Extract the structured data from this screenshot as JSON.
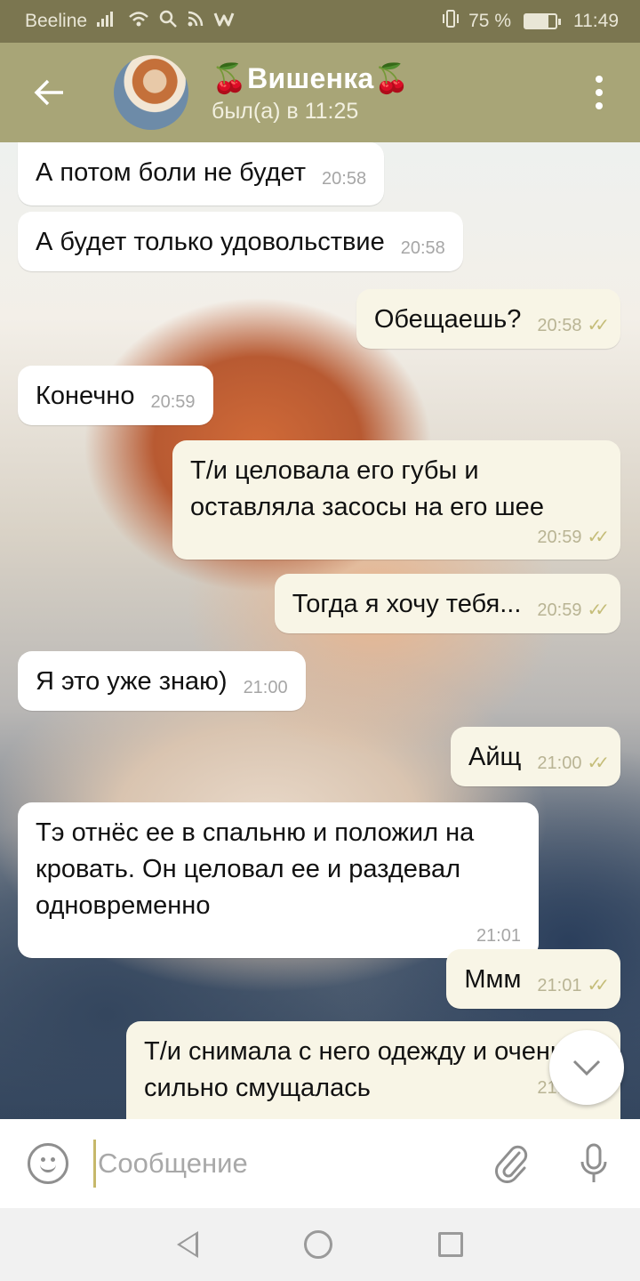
{
  "status_bar": {
    "carrier": "Beeline",
    "battery_text": "75 %",
    "battery_level": 0.75,
    "time": "11:49"
  },
  "header": {
    "title": "🍒Вишенка🍒",
    "status": "был(а) в 11:25"
  },
  "messages": [
    {
      "dir": "in",
      "text": "А потом боли не будет",
      "time": "20:58"
    },
    {
      "dir": "in",
      "text": "А будет только удовольствие",
      "time": "20:58"
    },
    {
      "dir": "out",
      "text": "Обещаешь?",
      "time": "20:58"
    },
    {
      "dir": "in",
      "text": "Конечно",
      "time": "20:59"
    },
    {
      "dir": "out",
      "text": "Т/и целовала его губы и оставляла засосы на его шее",
      "time": "20:59"
    },
    {
      "dir": "out",
      "text": "Тогда я хочу тебя...",
      "time": "20:59"
    },
    {
      "dir": "in",
      "text": "Я это уже знаю)",
      "time": "21:00"
    },
    {
      "dir": "out",
      "text": "Айщ",
      "time": "21:00"
    },
    {
      "dir": "in",
      "text": "Тэ отнёс ее в спальню и положил на кровать. Он целовал ее и раздевал одновременно",
      "time": "21:01"
    },
    {
      "dir": "out",
      "text": "Ммм",
      "time": "21:01"
    },
    {
      "dir": "out",
      "text": "Т/и снимала с него одежду и очень сильно смущалась",
      "time": "21:01"
    }
  ],
  "input": {
    "placeholder": "Сообщение"
  },
  "icons": {
    "back": "arrow-left-icon",
    "menu": "more-vertical-icon",
    "emoji": "smile-icon",
    "attach": "paperclip-icon",
    "mic": "microphone-icon",
    "scroll_down": "chevron-down-icon",
    "read_status": "double-check-icon"
  },
  "colors": {
    "header": "#a8a577",
    "status_bar": "#7b7650",
    "incoming_bubble": "#ffffff",
    "outgoing_bubble": "#f8f5e6",
    "check": "#c5bd79"
  }
}
